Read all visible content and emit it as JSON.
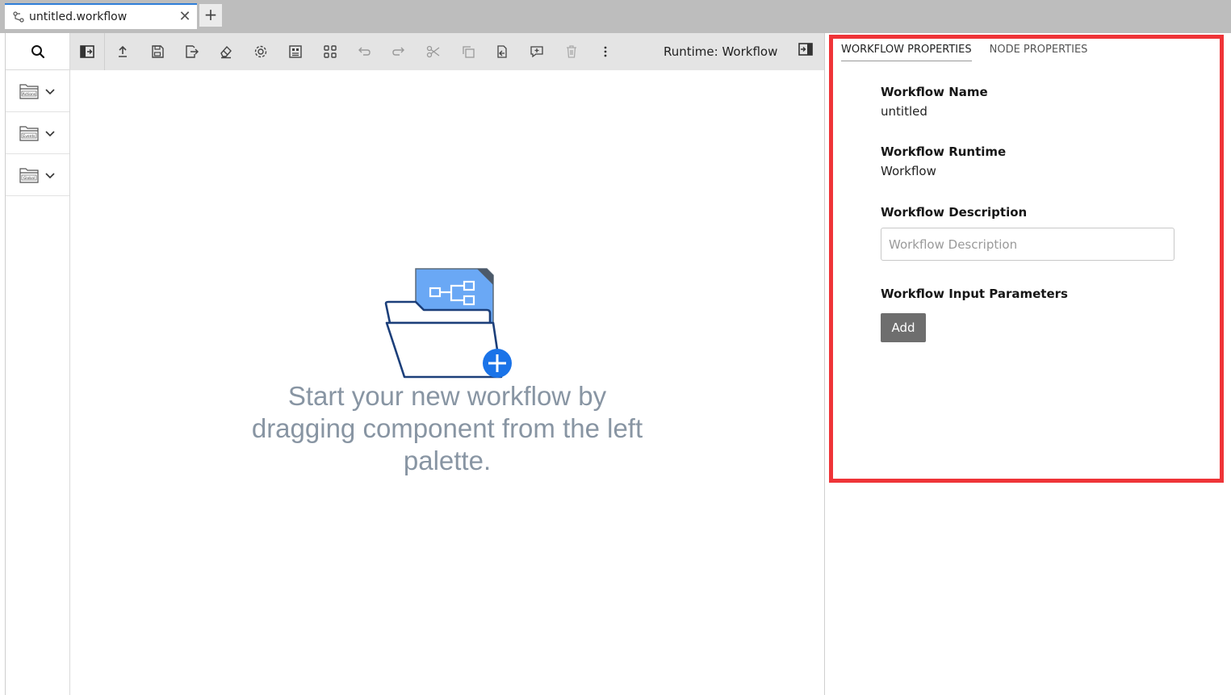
{
  "tab": {
    "label": "untitled.workflow",
    "close_glyph": "✕",
    "new_tab_glyph": "+"
  },
  "palette": {
    "items": [
      {
        "name": "Actions",
        "icon": "folder-icon"
      },
      {
        "name": "Events",
        "icon": "folder-icon"
      },
      {
        "name": "Global",
        "icon": "folder-icon"
      }
    ]
  },
  "toolbar": {
    "runtime_label": "Runtime: Workflow",
    "buttons": [
      "toggle-palette-icon",
      "upload-icon",
      "save-icon",
      "export-icon",
      "clear-icon",
      "settings-icon",
      "format-icon",
      "arrange-icon",
      "undo-icon",
      "redo-icon",
      "cut-icon",
      "copy-icon",
      "paste-icon",
      "comment-icon",
      "delete-icon",
      "more-icon"
    ]
  },
  "canvas": {
    "empty_message": "Start your new workflow by dragging component from the left palette."
  },
  "properties": {
    "tabs": [
      "WORKFLOW PROPERTIES",
      "NODE PROPERTIES"
    ],
    "active_tab": "WORKFLOW PROPERTIES",
    "workflow_name_label": "Workflow Name",
    "workflow_name_value": "untitled",
    "workflow_runtime_label": "Workflow Runtime",
    "workflow_runtime_value": "Workflow",
    "workflow_description_label": "Workflow Description",
    "workflow_description_placeholder": "Workflow Description",
    "workflow_input_params_label": "Workflow Input Parameters",
    "add_button_label": "Add"
  },
  "colors": {
    "accent": "#2f7ed8",
    "highlight_border": "#ef3438",
    "add_button": "#6e6e6e",
    "empty_text": "#8895a3"
  }
}
